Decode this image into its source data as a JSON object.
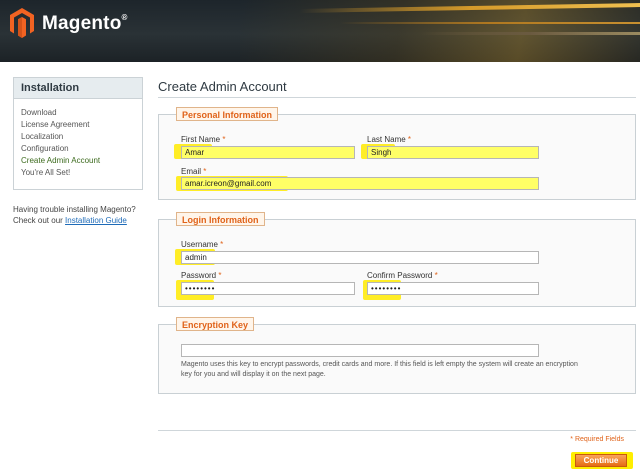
{
  "header": {
    "brand": "Magento",
    "trademark": "®",
    "logo_icon": "magento-logo-icon"
  },
  "sidebar": {
    "title": "Installation",
    "items": [
      {
        "label": "Download",
        "active": false
      },
      {
        "label": "License Agreement",
        "active": false
      },
      {
        "label": "Localization",
        "active": false
      },
      {
        "label": "Configuration",
        "active": false
      },
      {
        "label": "Create Admin Account",
        "active": true
      },
      {
        "label": "You're All Set!",
        "active": false
      }
    ],
    "help_line1": "Having trouble installing Magento?",
    "help_line2_prefix": "Check out our ",
    "help_link": "Installation Guide"
  },
  "main": {
    "title": "Create Admin Account",
    "personal": {
      "legend": "Personal Information",
      "first_name_label": "First Name",
      "first_name_value": "Amar",
      "last_name_label": "Last Name",
      "last_name_value": "Singh",
      "email_label": "Email",
      "email_value": "amar.icreon@gmail.com"
    },
    "login": {
      "legend": "Login Information",
      "username_label": "Username",
      "username_value": "admin",
      "password_label": "Password",
      "password_value": "••••••••",
      "confirm_label": "Confirm Password",
      "confirm_value": "••••••••"
    },
    "encryption": {
      "legend": "Encryption Key",
      "key_value": "",
      "note_line1": "Magento uses this key to encrypt passwords, credit cards and more. If this field is left empty the system will create an encryption",
      "note_line2": "key for you and will display it on the next page."
    },
    "required_marker": "*",
    "required_note": "* Required Fields",
    "continue_label": "Continue"
  },
  "colors": {
    "accent": "#e0631a",
    "highlight": "#ffee00",
    "header_bg": "#1d252b"
  }
}
